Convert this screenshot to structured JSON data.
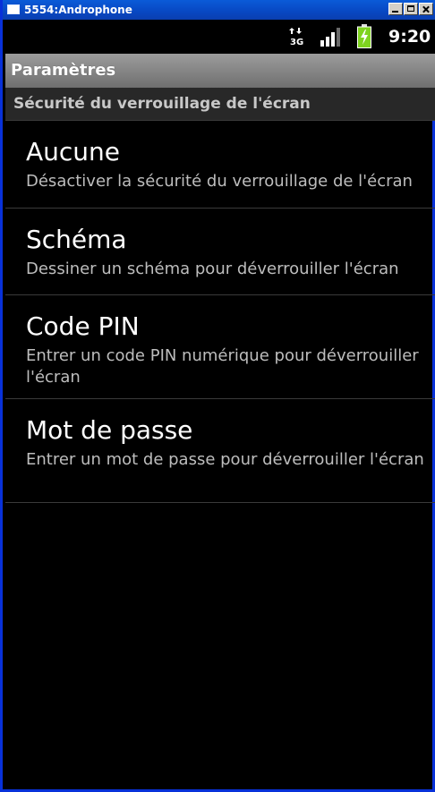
{
  "window": {
    "title": "5554:Androphone"
  },
  "statusbar": {
    "network_icon": "3g-data-icon",
    "signal_icon": "signal-strength-icon",
    "battery_icon": "battery-charging-icon",
    "time": "9:20",
    "colors": {
      "battery": "#7fd320",
      "icons": "#ffffff"
    }
  },
  "appbar": {
    "title": "Paramètres"
  },
  "section": {
    "label": "Sécurité du verrouillage de l'écran"
  },
  "options": [
    {
      "title": "Aucune",
      "summary": "Désactiver la sécurité du verrouillage de l'écran"
    },
    {
      "title": "Schéma",
      "summary": "Dessiner un schéma pour déverrouiller l'écran"
    },
    {
      "title": "Code PIN",
      "summary": "Entrer un code PIN numérique pour déverrouiller l'écran"
    },
    {
      "title": "Mot de passe",
      "summary": "Entrer un mot de passe pour déverrouiller l'écran"
    }
  ]
}
